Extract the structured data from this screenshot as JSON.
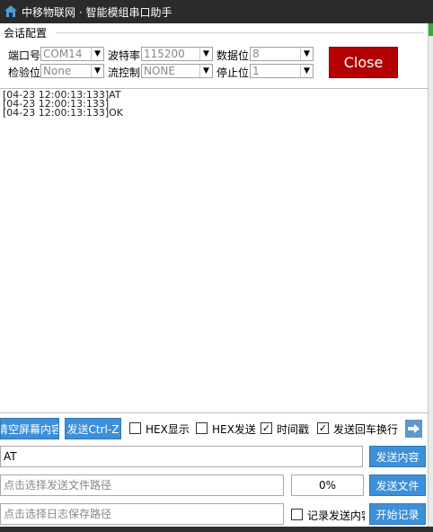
{
  "window": {
    "title": "中移物联网 · 智能模组串口助手"
  },
  "session": {
    "group_title": "会话配置",
    "port_label": "端口号",
    "port_value": "COM14",
    "baud_label": "波特率",
    "baud_value": "115200",
    "databits_label": "数据位",
    "databits_value": "8",
    "parity_label": "检验位",
    "parity_value": "None",
    "flow_label": "流控制",
    "flow_value": "NONE",
    "stopbits_label": "停止位",
    "stopbits_value": "1",
    "close_label": "Close"
  },
  "log": {
    "lines": [
      "[04-23 12:00:13:133]AT",
      "[04-23 12:00:13:133]",
      "[04-23 12:00:13:133]OK"
    ]
  },
  "toolbar": {
    "clear_label": "清空屏幕内容",
    "send_ctrlz_label": "发送Ctrl-Z",
    "hex_display_label": "HEX显示",
    "hex_display_checked": false,
    "hex_send_label": "HEX发送",
    "hex_send_checked": false,
    "timestamp_label": "时间戳",
    "timestamp_checked": true,
    "send_newline_label": "发送回车换行",
    "send_newline_checked": true,
    "check_mark": "✓"
  },
  "send": {
    "input_value": "AT",
    "send_button_label": "发送内容",
    "file_path_placeholder": "点击选择发送文件路径",
    "file_progress": "0%",
    "send_file_label": "发送文件",
    "log_path_placeholder": "点击选择日志保存路径",
    "record_label": "记录发送内容",
    "record_checked": false,
    "start_log_label": "开始记录"
  },
  "icons": {
    "app": "house-icon",
    "dropdown": "chevron-down-icon",
    "arrow": "arrow-right-icon"
  }
}
